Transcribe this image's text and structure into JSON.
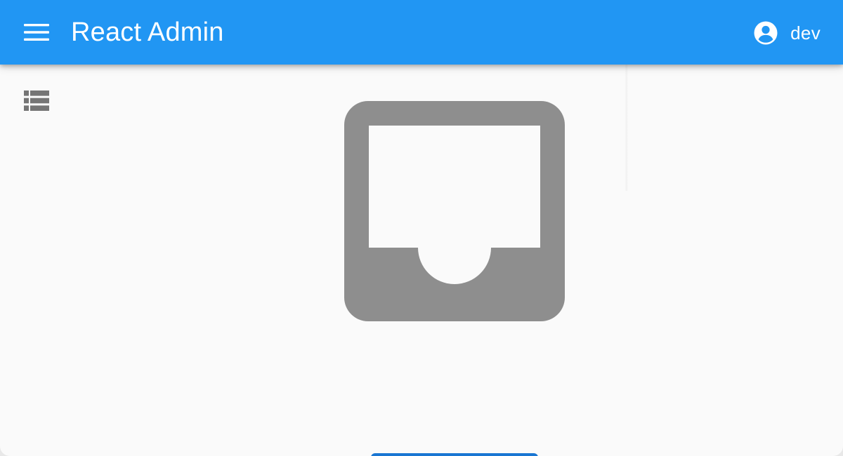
{
  "appbar": {
    "title": "React Admin",
    "background_color": "#2196f3",
    "menu_icon": "hamburger-menu-icon"
  },
  "user": {
    "name": "dev",
    "icon": "account-circle-icon"
  },
  "sidebar": {
    "items": [
      {
        "icon": "view-list-icon"
      }
    ]
  },
  "main": {
    "empty_state_icon": "inbox-icon",
    "empty_state_icon_color": "#8e8e8e",
    "primary_action_color": "#1976d2"
  }
}
